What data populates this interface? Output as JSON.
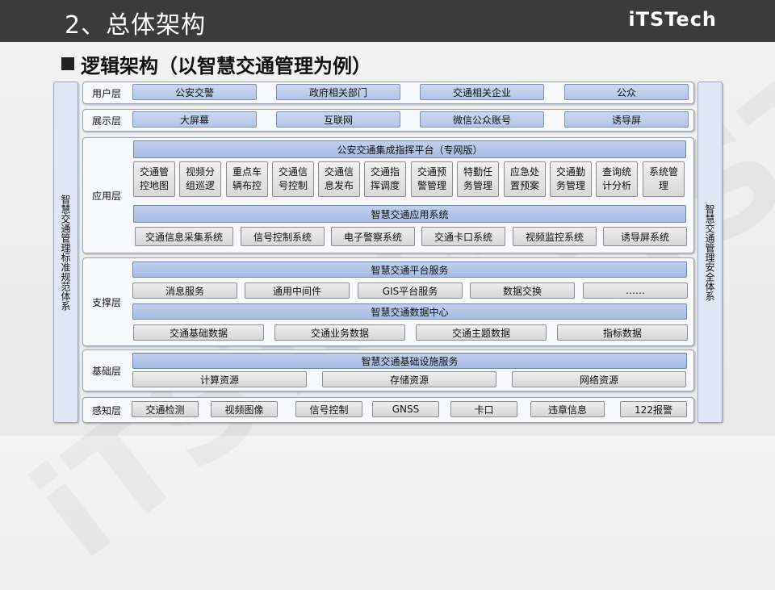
{
  "header": {
    "title": "2、总体架构",
    "logo": "iTSTech"
  },
  "watermark": "iTSTech",
  "subtitle": "逻辑架构（以智慧交通管理为例）",
  "left_side": "智慧交通管理标准规范体系",
  "right_side": "智慧交通管理安全体系",
  "layers": {
    "user": {
      "name": "用户层",
      "items": [
        "公安交警",
        "政府相关部门",
        "交通相关企业",
        "公众"
      ]
    },
    "display": {
      "name": "展示层",
      "items": [
        "大屏幕",
        "互联网",
        "微信公众账号",
        "诱导屏"
      ]
    },
    "app": {
      "name": "应用层",
      "platform": "公安交通集成指挥平台（专网版）",
      "modules": [
        "交通管控地图",
        "视频分组巡逻",
        "重点车辆布控",
        "交通信号控制",
        "交通信息发布",
        "交通指挥调度",
        "交通预警管理",
        "特勤任务管理",
        "应急处置预案",
        "交通勤务管理",
        "查询统计分析",
        "系统管理"
      ],
      "system": "智慧交通应用系统",
      "subsystems": [
        "交通信息采集系统",
        "信号控制系统",
        "电子警察系统",
        "交通卡口系统",
        "视频监控系统",
        "诱导屏系统"
      ]
    },
    "support": {
      "name": "支撑层",
      "platform_service": "智慧交通平台服务",
      "services": [
        "消息服务",
        "通用中间件",
        "GIS平台服务",
        "数据交换",
        "……"
      ],
      "data_center": "智慧交通数据中心",
      "data": [
        "交通基础数据",
        "交通业务数据",
        "交通主题数据",
        "指标数据"
      ]
    },
    "base": {
      "name": "基础层",
      "service": "智慧交通基础设施服务",
      "resources": [
        "计算资源",
        "存储资源",
        "网络资源"
      ]
    },
    "sense": {
      "name": "感知层",
      "items": [
        "交通检测",
        "视频图像",
        "信号控制",
        "GNSS",
        "卡口",
        "违章信息",
        "122报警"
      ]
    }
  }
}
